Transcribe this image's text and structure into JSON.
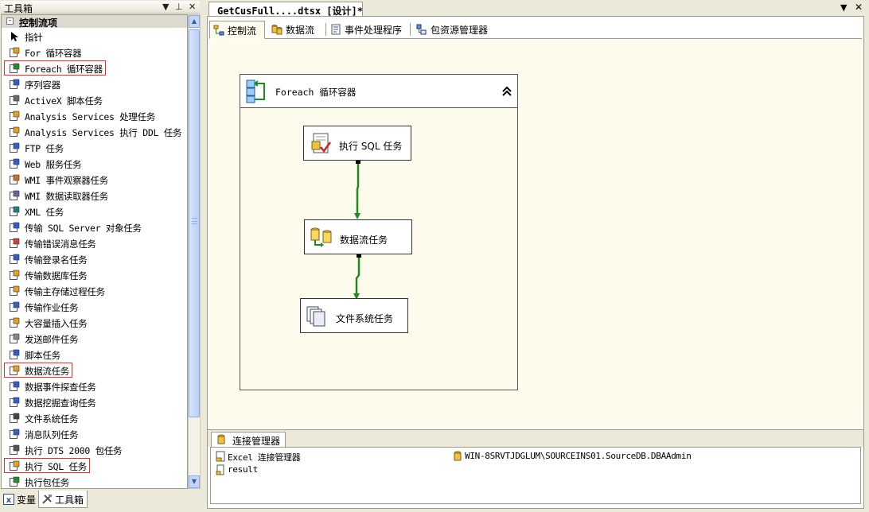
{
  "toolbox": {
    "title": "工具箱",
    "pin": "▾ ",
    "pin_glyph": "ᵖ",
    "close_glyph": "✕",
    "section": "控制流项",
    "items": [
      {
        "label": "指针",
        "icon": "pointer-icon",
        "highlighted": false
      },
      {
        "label": "For 循环容器",
        "icon": "for-loop-icon",
        "highlighted": false
      },
      {
        "label": "Foreach 循环容器",
        "icon": "foreach-loop-icon",
        "highlighted": true
      },
      {
        "label": "序列容器",
        "icon": "sequence-container-icon",
        "highlighted": false
      },
      {
        "label": "ActiveX 脚本任务",
        "icon": "activex-icon",
        "highlighted": false
      },
      {
        "label": "Analysis Services 处理任务",
        "icon": "analysis-process-icon",
        "highlighted": false
      },
      {
        "label": "Analysis Services 执行 DDL 任务",
        "icon": "analysis-ddl-icon",
        "highlighted": false
      },
      {
        "label": "FTP 任务",
        "icon": "ftp-icon",
        "highlighted": false
      },
      {
        "label": "Web 服务任务",
        "icon": "web-service-icon",
        "highlighted": false
      },
      {
        "label": "WMI 事件观察器任务",
        "icon": "wmi-event-icon",
        "highlighted": false
      },
      {
        "label": "WMI 数据读取器任务",
        "icon": "wmi-reader-icon",
        "highlighted": false
      },
      {
        "label": "XML 任务",
        "icon": "xml-icon",
        "highlighted": false
      },
      {
        "label": "传输 SQL Server 对象任务",
        "icon": "transfer-objects-icon",
        "highlighted": false
      },
      {
        "label": "传输错误消息任务",
        "icon": "transfer-errors-icon",
        "highlighted": false
      },
      {
        "label": "传输登录名任务",
        "icon": "transfer-logins-icon",
        "highlighted": false
      },
      {
        "label": "传输数据库任务",
        "icon": "transfer-database-icon",
        "highlighted": false
      },
      {
        "label": "传输主存储过程任务",
        "icon": "transfer-procs-icon",
        "highlighted": false
      },
      {
        "label": "传输作业任务",
        "icon": "transfer-jobs-icon",
        "highlighted": false
      },
      {
        "label": "大容量插入任务",
        "icon": "bulk-insert-icon",
        "highlighted": false
      },
      {
        "label": "发送邮件任务",
        "icon": "send-mail-icon",
        "highlighted": false
      },
      {
        "label": "脚本任务",
        "icon": "script-icon",
        "highlighted": false
      },
      {
        "label": "数据流任务",
        "icon": "data-flow-icon",
        "highlighted": true
      },
      {
        "label": "数据事件探查任务",
        "icon": "data-profiling-icon",
        "highlighted": false
      },
      {
        "label": "数据挖掘查询任务",
        "icon": "data-mining-icon",
        "highlighted": false
      },
      {
        "label": "文件系统任务",
        "icon": "file-system-icon",
        "highlighted": false
      },
      {
        "label": "消息队列任务",
        "icon": "message-queue-icon",
        "highlighted": false
      },
      {
        "label": "执行 DTS 2000 包任务",
        "icon": "dts2000-icon",
        "highlighted": false
      },
      {
        "label": "执行 SQL 任务",
        "icon": "execute-sql-icon",
        "highlighted": true
      },
      {
        "label": "执行包任务",
        "icon": "execute-package-icon",
        "highlighted": false
      }
    ],
    "bottom_tabs": {
      "variables": "变量",
      "toolbox": "工具箱"
    }
  },
  "document": {
    "tab_title": "GetCusFull....dtsx [设计]*",
    "designer_tabs": [
      "控制流",
      "数据流",
      "事件处理程序",
      "包资源管理器"
    ],
    "active_tab": "控制流",
    "container": {
      "label": "Foreach 循环容器",
      "collapse": "⌃"
    },
    "tasks": [
      "执行 SQL 任务",
      "数据流任务",
      "文件系统任务"
    ],
    "connection_manager": {
      "tab": "连接管理器",
      "items": [
        "Excel 连接管理器",
        "WIN-8SRVTJDGLUM\\SOURCEINS01.SourceDB.DBAAdmin",
        "result"
      ]
    }
  },
  "colors": {
    "highlight": "#e03030",
    "precedence": "#1f8a1f",
    "canvas": "#fdfbeb"
  }
}
